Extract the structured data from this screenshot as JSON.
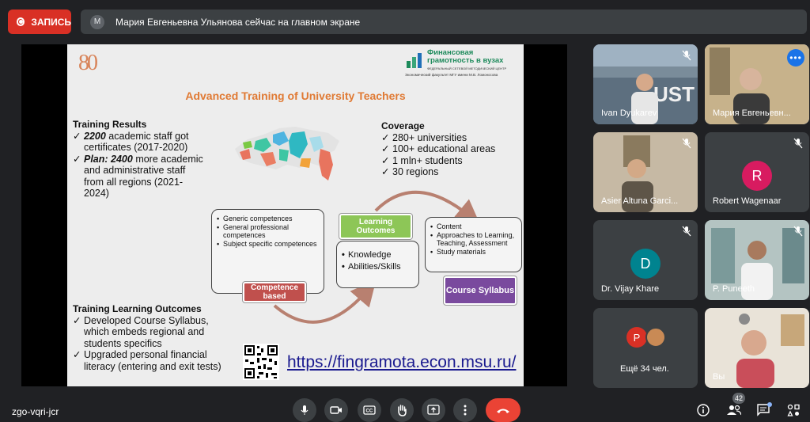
{
  "recording": {
    "label": "ЗАПИСЬ"
  },
  "presenter_notice": {
    "avatar_letter": "М",
    "text": "Мария Евгеньевна Ульянова сейчас на главном экране"
  },
  "slide": {
    "logo_80": "80",
    "fin_logo": {
      "line1": "Финансовая",
      "line2": "грамотность в вузах",
      "line3": "ФЕДЕРАЛЬНЫЙ СЕТЕВОЙ МЕТОДИЧЕСКИЙ ЦЕНТР",
      "line4": "Экономический факультет МГУ имени М.В. Ломоносова"
    },
    "title": "Advanced Training of University Teachers",
    "training_results": {
      "heading": "Training Results",
      "item1_bold": "2200",
      "item1_rest": " academic staff got certificates (2017-2020)",
      "item2_bold": "Plan: 2400",
      "item2_rest": " more academic and administrative staff from all regions (2021-2024)"
    },
    "coverage": {
      "heading": "Coverage",
      "items": [
        "280+ universities",
        "100+ educational areas",
        "1 mln+ students",
        "30 regions"
      ]
    },
    "competences_box": [
      "Generic competences",
      "General professional competences",
      "Subject specific competences"
    ],
    "competence_label": "Competence based",
    "learning_outcomes_label": "Learning Outcomes",
    "knowledge_box": [
      "Knowledge",
      "Abilities/Skills"
    ],
    "content_box": [
      "Content",
      "Approaches to Learning, Teaching, Assessment",
      "Study materials"
    ],
    "course_syllabus_label": "Course Syllabus",
    "training_outcomes": {
      "heading": "Training Learning Outcomes",
      "items": [
        "Developed Course Syllabus, which embeds regional and students specifics",
        "Upgraded personal financial literacy (entering and exit tests)"
      ]
    },
    "url": "https://fingramota.econ.msu.ru/"
  },
  "participants": [
    {
      "name": "Ivan Dyukarev"
    },
    {
      "name": "Мария Евгеньевн..."
    },
    {
      "name": "Asier Altuna Garci..."
    },
    {
      "name": "Robert Wagenaar",
      "letter": "R",
      "color": "#d81b60"
    },
    {
      "name": "Dr. Vijay Khare",
      "letter": "D",
      "color": "#00838f"
    },
    {
      "name": "P. Puneeth"
    },
    {
      "name": "Ещё 34 чел.",
      "letter": "P",
      "color": "#d93025"
    },
    {
      "name": "Вы"
    }
  ],
  "bottom": {
    "meeting_code": "zgo-vqri-jcr",
    "people_count": "42"
  }
}
